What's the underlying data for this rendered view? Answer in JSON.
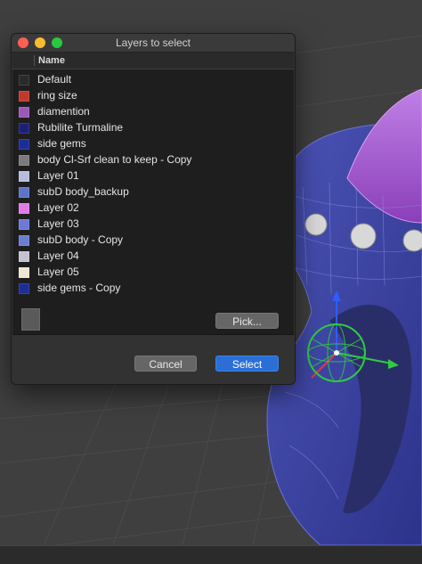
{
  "dialog": {
    "title": "Layers to select",
    "column_header": "Name",
    "buttons": {
      "pick": "Pick...",
      "cancel": "Cancel",
      "select": "Select"
    }
  },
  "layers": [
    {
      "name": "Default",
      "color": "#2a2a2a"
    },
    {
      "name": "ring size",
      "color": "#c0392b"
    },
    {
      "name": "diamention",
      "color": "#9b59b6"
    },
    {
      "name": "Rubilite Turmaline",
      "color": "#1c1f7a"
    },
    {
      "name": "side gems",
      "color": "#1b2d96"
    },
    {
      "name": "body Cl-Srf clean to keep - Copy",
      "color": "#7a7a80"
    },
    {
      "name": "Layer 01",
      "color": "#b7bddc"
    },
    {
      "name": "subD body_backup",
      "color": "#5d74c9"
    },
    {
      "name": "Layer 02",
      "color": "#e07be6"
    },
    {
      "name": "Layer 03",
      "color": "#6f78d8"
    },
    {
      "name": "subD body - Copy",
      "color": "#6a7ed0"
    },
    {
      "name": "Layer 04",
      "color": "#c3c3cf"
    },
    {
      "name": "Layer 05",
      "color": "#efe7d3"
    },
    {
      "name": "side gems - Copy",
      "color": "#1b2d96"
    }
  ]
}
